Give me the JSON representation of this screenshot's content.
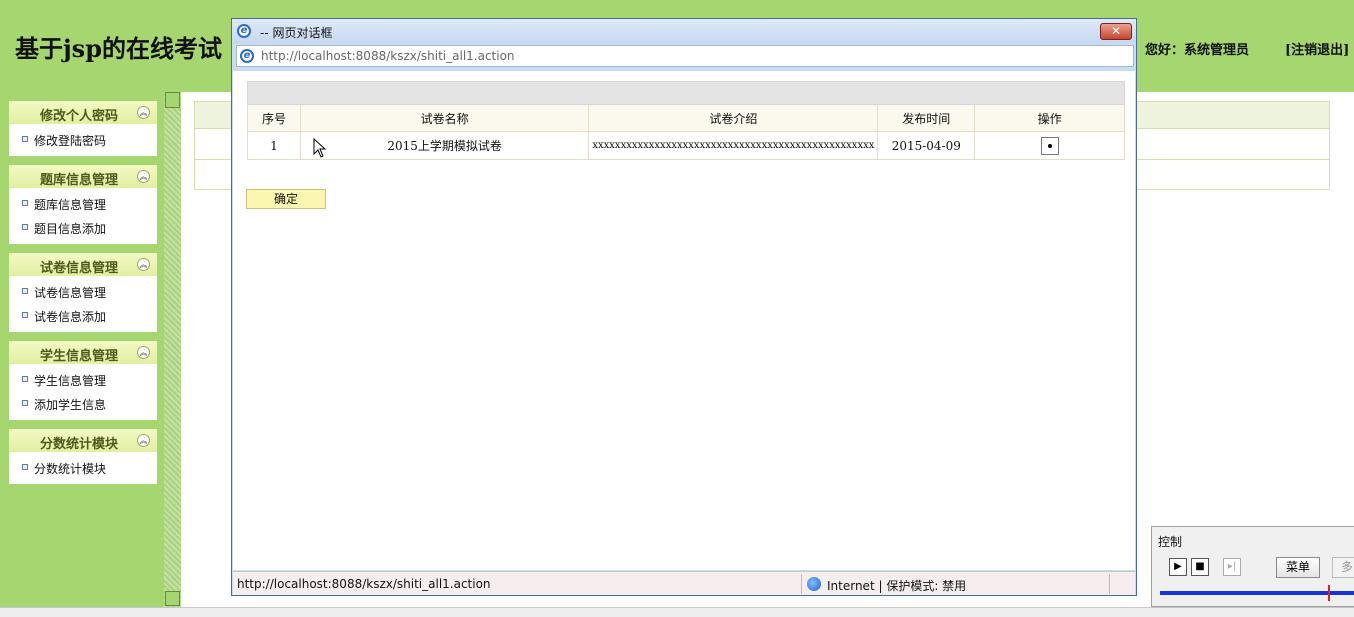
{
  "header": {
    "site_title": "基于jsp的在线考试",
    "greeting": "您好：系统管理员",
    "logout": "[注销退出]"
  },
  "sidebar": {
    "groups": [
      {
        "title": "修改个人密码",
        "items": [
          "修改登陆密码"
        ]
      },
      {
        "title": "题库信息管理",
        "items": [
          "题库信息管理",
          "题目信息添加"
        ]
      },
      {
        "title": "试卷信息管理",
        "items": [
          "试卷信息管理",
          "试卷信息添加"
        ]
      },
      {
        "title": "学生信息管理",
        "items": [
          "学生信息管理",
          "添加学生信息"
        ]
      },
      {
        "title": "分数统计模块",
        "items": [
          "分数统计模块"
        ]
      }
    ]
  },
  "dialog": {
    "title": "-- 网页对话框",
    "address": "http://localhost:8088/kszx/shiti_all1.action",
    "table": {
      "columns": [
        "序号",
        "试卷名称",
        "试卷介绍",
        "发布时间",
        "操作"
      ],
      "rows": [
        {
          "index": "1",
          "name": "2015上学期模拟试卷",
          "intro": "xxxxxxxxxxxxxxxxxxxxxxxxxxxxxxxxxxxxxxxxxxxxxxxxxx",
          "date": "2015-04-09",
          "selected": true
        }
      ]
    },
    "confirm_label": "确定",
    "status_url": "http://localhost:8088/kszx/shiti_all1.action",
    "status_zone": "Internet | 保护模式: 禁用"
  },
  "control_panel": {
    "title": "控制",
    "menu_label": "菜单",
    "more_label": "多"
  }
}
